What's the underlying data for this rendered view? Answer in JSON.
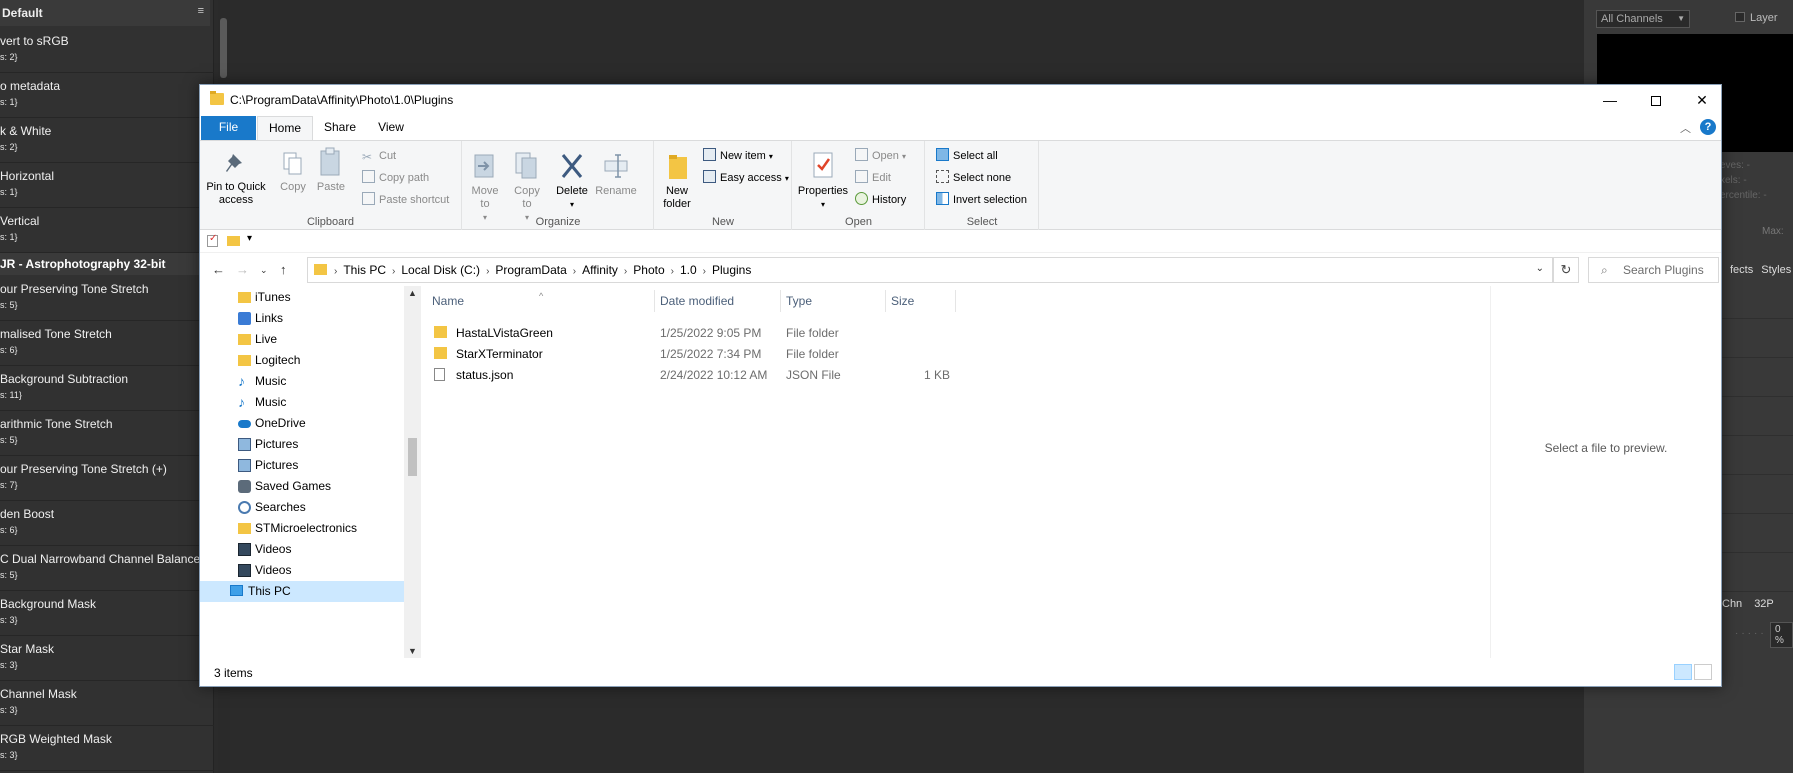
{
  "macros": {
    "header": "Default",
    "menu_icon": "≡",
    "items_top": [
      {
        "name": "vert to sRGB",
        "sub": "s: 2}"
      },
      {
        "name": "o metadata",
        "sub": "s: 1}"
      },
      {
        "name": "k & White",
        "sub": "s: 2}"
      },
      {
        "name": "Horizontal",
        "sub": "s: 1}"
      },
      {
        "name": "Vertical",
        "sub": "s: 1}"
      }
    ],
    "group": "JR - Astrophotography 32-bit",
    "items_group": [
      {
        "name": "our Preserving Tone Stretch",
        "sub": "s: 5}"
      },
      {
        "name": "malised Tone Stretch",
        "sub": "s: 6}"
      },
      {
        "name": "Background Subtraction",
        "sub": "s: 11}"
      },
      {
        "name": "arithmic Tone Stretch",
        "sub": "s: 5}"
      },
      {
        "name": "our Preserving Tone Stretch (+)",
        "sub": "s: 7}"
      },
      {
        "name": "den Boost",
        "sub": "s: 6}"
      },
      {
        "name": "C Dual Narrowband Channel Balance",
        "sub": "s: 5}"
      },
      {
        "name": "Background Mask",
        "sub": "s: 3}"
      },
      {
        "name": "Star Mask",
        "sub": "s: 3}"
      },
      {
        "name": "Channel Mask",
        "sub": "s: 3}"
      },
      {
        "name": "RGB Weighted Mask",
        "sub": "s: 3}"
      }
    ]
  },
  "right_panel": {
    "channel_select": "All Channels",
    "layer_label": "Layer",
    "stats": [
      "eves: -",
      "xels: -",
      "ercentile: -"
    ],
    "max_label": "Max:",
    "tabs": [
      "fects",
      "Styles"
    ],
    "chn_labels": [
      "Chn",
      "32P"
    ],
    "zoom_value": "0 %"
  },
  "explorer": {
    "title": "C:\\ProgramData\\Affinity\\Photo\\1.0\\Plugins",
    "window_controls": {
      "minimize": "—",
      "close": "✕"
    },
    "tabs": {
      "file": "File",
      "home": "Home",
      "share": "Share",
      "view": "View"
    },
    "ribbon": {
      "clipboard": {
        "label": "Clipboard",
        "pin": "Pin to Quick access",
        "copy": "Copy",
        "paste": "Paste",
        "cut": "Cut",
        "copy_path": "Copy path",
        "paste_shortcut": "Paste shortcut"
      },
      "organize": {
        "label": "Organize",
        "move_to": "Move to",
        "copy_to": "Copy to",
        "delete": "Delete",
        "rename": "Rename"
      },
      "new": {
        "label": "New",
        "new_folder": "New folder",
        "new_item": "New item",
        "easy_access": "Easy access"
      },
      "open": {
        "label": "Open",
        "properties": "Properties",
        "open": "Open",
        "edit": "Edit",
        "history": "History"
      },
      "select": {
        "label": "Select",
        "select_all": "Select all",
        "select_none": "Select none",
        "invert": "Invert selection"
      }
    },
    "breadcrumbs": [
      "This PC",
      "Local Disk (C:)",
      "ProgramData",
      "Affinity",
      "Photo",
      "1.0",
      "Plugins"
    ],
    "search_placeholder": "Search Plugins",
    "nav_items": [
      {
        "label": "iTunes",
        "icon": "folder-icon"
      },
      {
        "label": "Links",
        "icon": "links-icon"
      },
      {
        "label": "Live",
        "icon": "folder-icon"
      },
      {
        "label": "Logitech",
        "icon": "folder-icon"
      },
      {
        "label": "Music",
        "icon": "music-icon"
      },
      {
        "label": "Music",
        "icon": "music-icon"
      },
      {
        "label": "OneDrive",
        "icon": "cloud-icon"
      },
      {
        "label": "Pictures",
        "icon": "pictures-icon"
      },
      {
        "label": "Pictures",
        "icon": "pictures-icon"
      },
      {
        "label": "Saved Games",
        "icon": "games-icon"
      },
      {
        "label": "Searches",
        "icon": "search-icon"
      },
      {
        "label": "STMicroelectronics",
        "icon": "folder-icon"
      },
      {
        "label": "Videos",
        "icon": "video-icon"
      },
      {
        "label": "Videos",
        "icon": "video-icon"
      },
      {
        "label": "This PC",
        "icon": "computer-icon"
      }
    ],
    "columns": {
      "name": "Name",
      "date": "Date modified",
      "type": "Type",
      "size": "Size"
    },
    "files": [
      {
        "name": "HastaLVistaGreen",
        "date": "1/25/2022 9:05 PM",
        "type": "File folder",
        "size": "",
        "icon": "folder-icon"
      },
      {
        "name": "StarXTerminator",
        "date": "1/25/2022 7:34 PM",
        "type": "File folder",
        "size": "",
        "icon": "folder-icon"
      },
      {
        "name": "status.json",
        "date": "2/24/2022 10:12 AM",
        "type": "JSON File",
        "size": "1 KB",
        "icon": "file-icon"
      }
    ],
    "preview_message": "Select a file to preview.",
    "status": "3 items"
  }
}
